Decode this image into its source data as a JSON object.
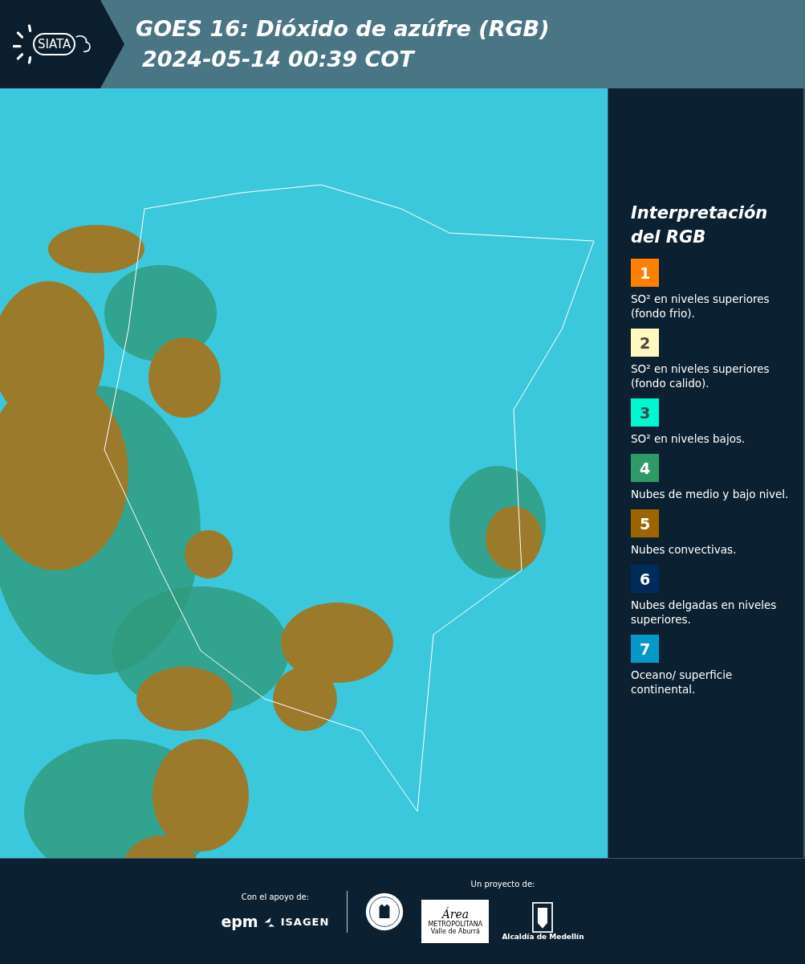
{
  "header": {
    "logo_text": "SIATA",
    "title": "GOES 16: Dióxido de azúfre (RGB)",
    "timestamp": "2024-05-14 00:39 COT"
  },
  "legend": {
    "title": "Interpretación del RGB",
    "items": [
      {
        "number": "1",
        "color": "#ff7f00",
        "dark_text": false,
        "description": "SO² en niveles superiores (fondo frio)."
      },
      {
        "number": "2",
        "color": "#fff9c0",
        "dark_text": true,
        "description": "SO² en niveles superiores (fondo calido)."
      },
      {
        "number": "3",
        "color": "#00f7cf",
        "dark_text": true,
        "description": "SO² en niveles bajos."
      },
      {
        "number": "4",
        "color": "#2f9a68",
        "dark_text": false,
        "description": "Nubes de medio y bajo nivel."
      },
      {
        "number": "5",
        "color": "#9c6500",
        "dark_text": false,
        "description": "Nubes convectivas."
      },
      {
        "number": "6",
        "color": "#002c5c",
        "dark_text": false,
        "description": "Nubes delgadas en niveles superiores."
      },
      {
        "number": "7",
        "color": "#0699c8",
        "dark_text": false,
        "description": "Oceano/ superficie continental."
      }
    ]
  },
  "footer": {
    "support_label": "Con el apoyo de:",
    "support_logos": [
      "epm",
      "ISAGEN"
    ],
    "project_label": "Un proyecto de:",
    "area_logo": {
      "title": "Área",
      "line1": "METROPOLITANA",
      "line2": "Valle de Aburrá"
    },
    "alcaldia_label": "Alcaldía de Medellín"
  }
}
